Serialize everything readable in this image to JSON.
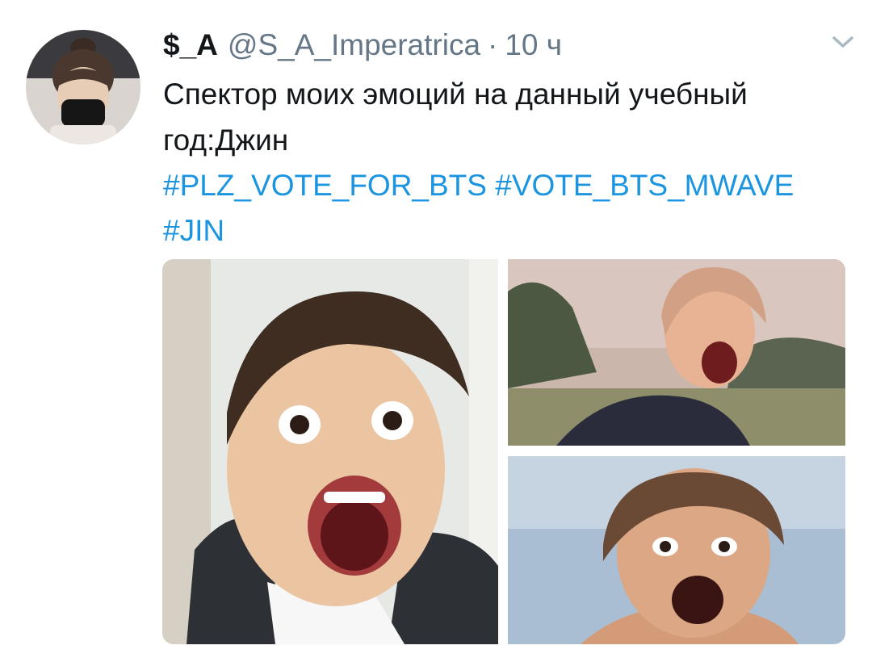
{
  "tweet": {
    "display_name": "$_A",
    "handle": "@S_A_Imperatrica",
    "separator": "·",
    "time": "10 ч",
    "text": "Спектор моих эмоций на данный учебный год:Джин",
    "hashtags": [
      "#PLZ_VOTE_FOR_BTS",
      "#VOTE_BTS_MWAVE",
      "#JIN"
    ],
    "link_color": "#1b95e0",
    "icons": {
      "menu": "chevron-down-icon"
    },
    "media": [
      {
        "name": "photo-1",
        "description_label": ""
      },
      {
        "name": "photo-2",
        "description_label": ""
      },
      {
        "name": "photo-3",
        "description_label": ""
      }
    ]
  }
}
